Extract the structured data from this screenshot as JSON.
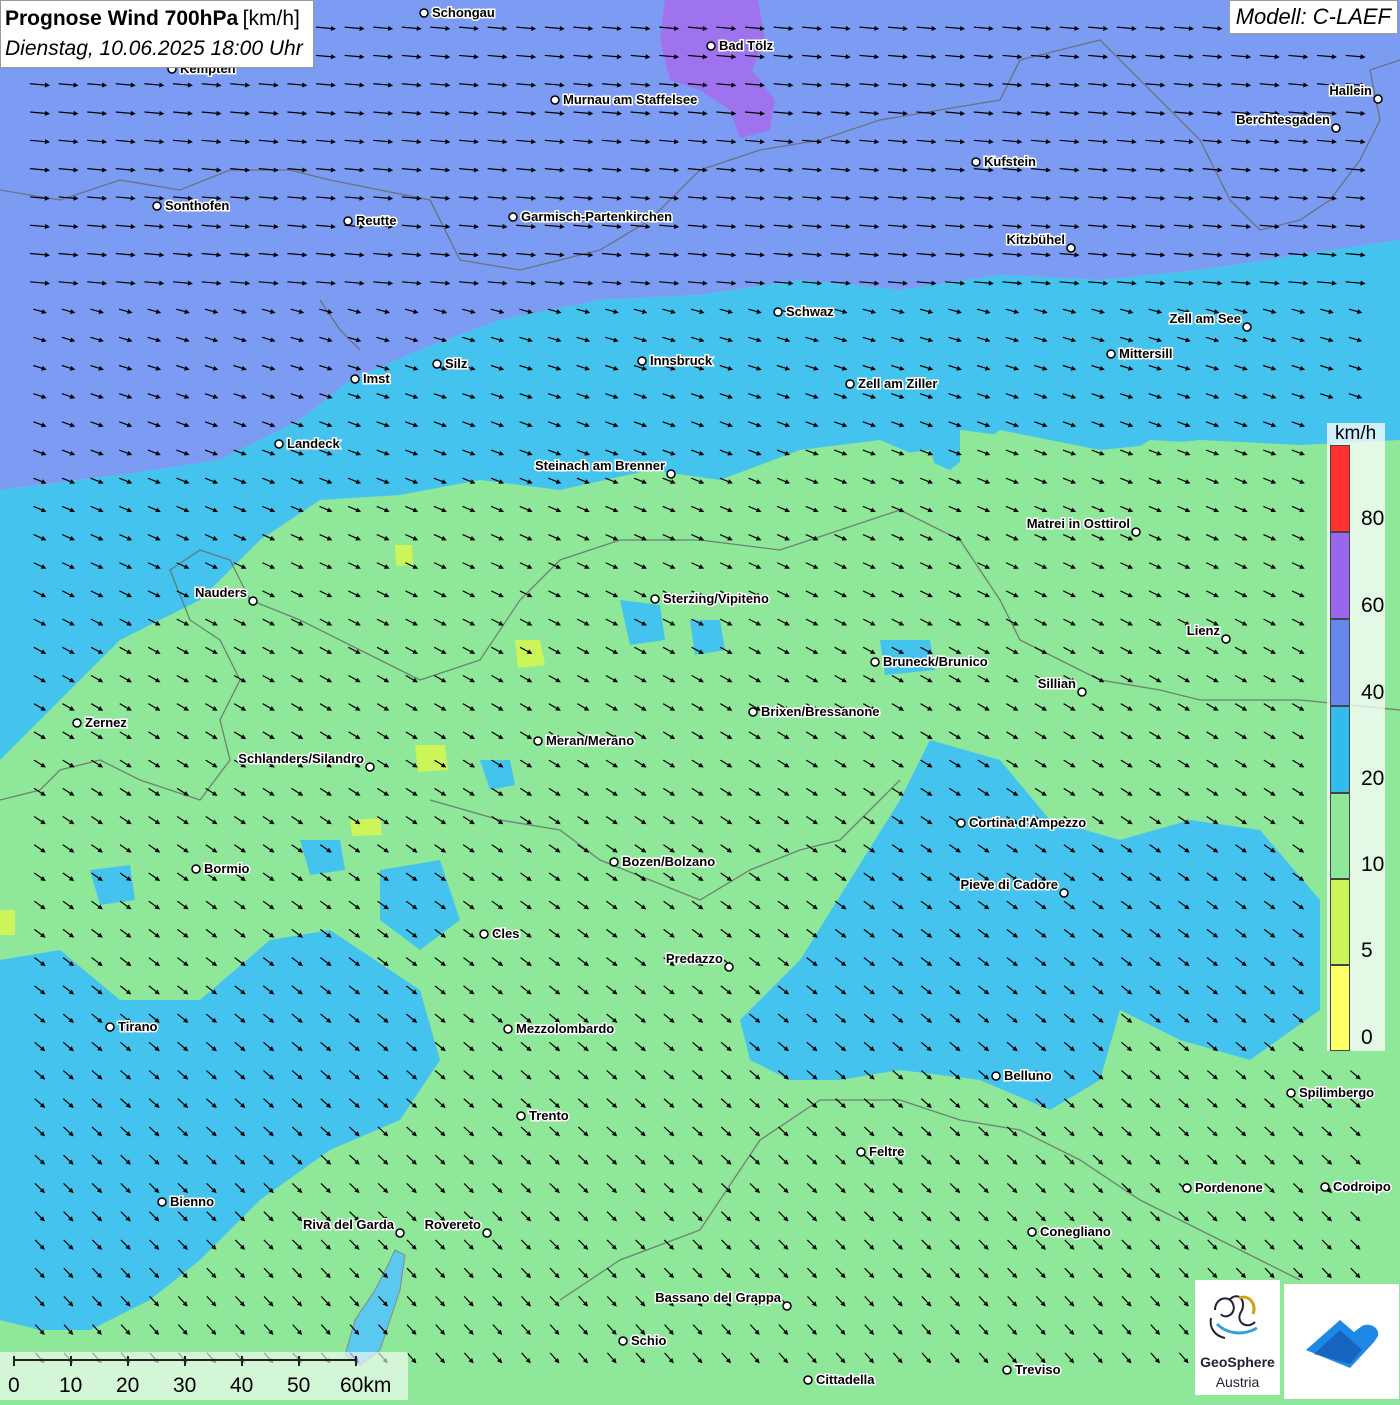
{
  "title": "Prognose Wind 700hPa",
  "title_unit": "[km/h]",
  "subtitle": "Dienstag, 10.06.2025 18:00 Uhr",
  "model": "Modell: C-LAEF",
  "legend": {
    "unit": "km/h",
    "labels": [
      "80",
      "60",
      "40",
      "20",
      "10",
      "5",
      "0"
    ],
    "colors": {
      "c80": "#ff3030",
      "c60": "#9966ee",
      "c40": "#6688ee",
      "c20": "#33bbee",
      "c10": "#8fe89a",
      "c5": "#ccf55a",
      "c0": "#ffff66"
    }
  },
  "scale": {
    "labels": [
      "0",
      "10",
      "20",
      "30",
      "40",
      "50",
      "60km"
    ]
  },
  "logos": {
    "geosphere_line1": "GeoSphere",
    "geosphere_line2": "Austria"
  },
  "cities": [
    {
      "name": "Schongau"
    },
    {
      "name": "Bad Tölz"
    },
    {
      "name": "Kempten"
    },
    {
      "name": "Murnau am Staffelsee"
    },
    {
      "name": "Hallein"
    },
    {
      "name": "Berchtesgaden"
    },
    {
      "name": "Kufstein"
    },
    {
      "name": "Sonthofen"
    },
    {
      "name": "Reutte"
    },
    {
      "name": "Garmisch-Partenkirchen"
    },
    {
      "name": "Kitzbühel"
    },
    {
      "name": "Schwaz"
    },
    {
      "name": "Zell am See"
    },
    {
      "name": "Mittersill"
    },
    {
      "name": "Innsbruck"
    },
    {
      "name": "Silz"
    },
    {
      "name": "Imst"
    },
    {
      "name": "Zell am Ziller"
    },
    {
      "name": "Landeck"
    },
    {
      "name": "Steinach am Brenner"
    },
    {
      "name": "Matrei in Osttirol"
    },
    {
      "name": "Nauders"
    },
    {
      "name": "Sterzing/Vipiteno"
    },
    {
      "name": "Lienz"
    },
    {
      "name": "Bruneck/Brunico"
    },
    {
      "name": "Sillian"
    },
    {
      "name": "Zernez"
    },
    {
      "name": "Brixen/Bressanone"
    },
    {
      "name": "Meran/Merano"
    },
    {
      "name": "Schlanders/Silandro"
    },
    {
      "name": "Cortina d'Ampezzo"
    },
    {
      "name": "Bozen/Bolzano"
    },
    {
      "name": "Bormio"
    },
    {
      "name": "Pieve di Cadore"
    },
    {
      "name": "Cles"
    },
    {
      "name": "Predazzo"
    },
    {
      "name": "Tirano"
    },
    {
      "name": "Mezzolombardo"
    },
    {
      "name": "Belluno"
    },
    {
      "name": "Spilimbergo"
    },
    {
      "name": "Trento"
    },
    {
      "name": "Feltre"
    },
    {
      "name": "Pordenone"
    },
    {
      "name": "Codroipo"
    },
    {
      "name": "Bienno"
    },
    {
      "name": "Riva del Garda"
    },
    {
      "name": "Rovereto"
    },
    {
      "name": "Conegliano"
    },
    {
      "name": "Bassano del Grappa"
    },
    {
      "name": "Schio"
    },
    {
      "name": "Treviso"
    },
    {
      "name": "Cittadella"
    }
  ]
}
